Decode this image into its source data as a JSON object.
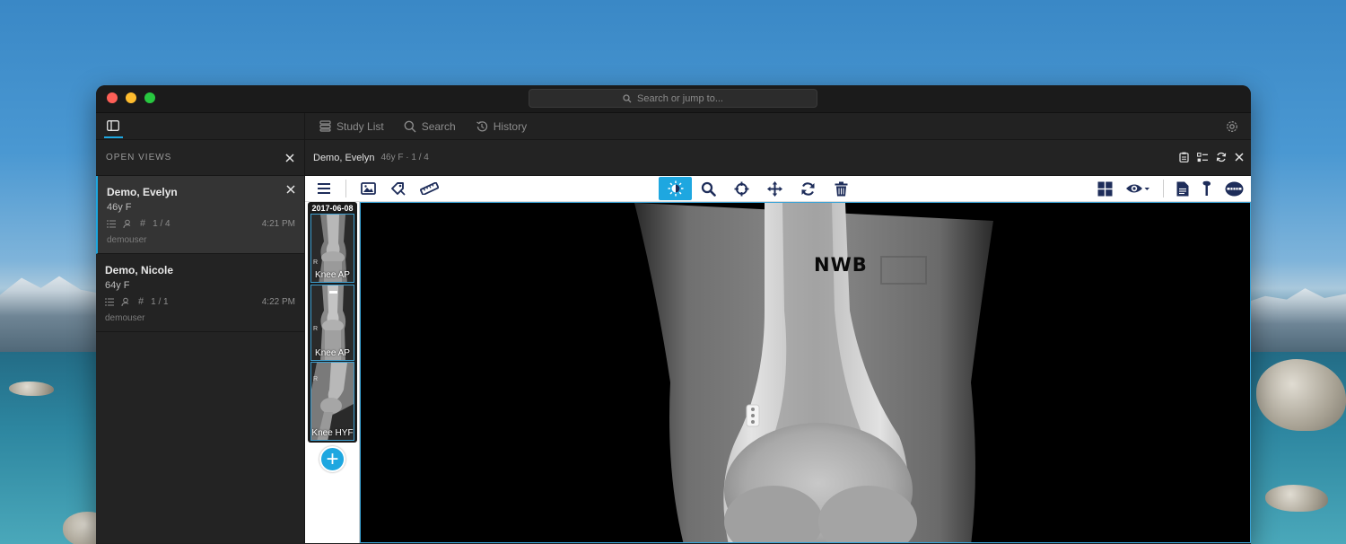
{
  "app": {
    "search_placeholder": "Search or jump to..."
  },
  "nav": {
    "items": [
      {
        "label": "Study List",
        "icon": "list-icon"
      },
      {
        "label": "Search",
        "icon": "search-icon"
      },
      {
        "label": "History",
        "icon": "history-icon"
      }
    ]
  },
  "sidebar": {
    "header": "OPEN VIEWS",
    "views": [
      {
        "name": "Demo, Evelyn",
        "demo": "46y F",
        "count": "1 / 4",
        "time": "4:21 PM",
        "user": "demouser",
        "active": true
      },
      {
        "name": "Demo, Nicole",
        "demo": "64y F",
        "count": "1 / 1",
        "time": "4:22 PM",
        "user": "demouser",
        "active": false
      }
    ]
  },
  "study": {
    "name": "Demo, Evelyn",
    "info": "46y F · 1 / 4"
  },
  "toolbar": {
    "active_tool": "window-level"
  },
  "thumbnails": {
    "date": "2017-06-08",
    "items": [
      {
        "label": "Knee AP"
      },
      {
        "label": "Knee AP"
      },
      {
        "label": "Knee HYF"
      }
    ],
    "add_label": "+"
  },
  "image": {
    "annotation": "NWB"
  },
  "colors": {
    "accent": "#1ea7e0",
    "toolbar_icon": "#1e2d5a",
    "window_bg": "#202020"
  }
}
